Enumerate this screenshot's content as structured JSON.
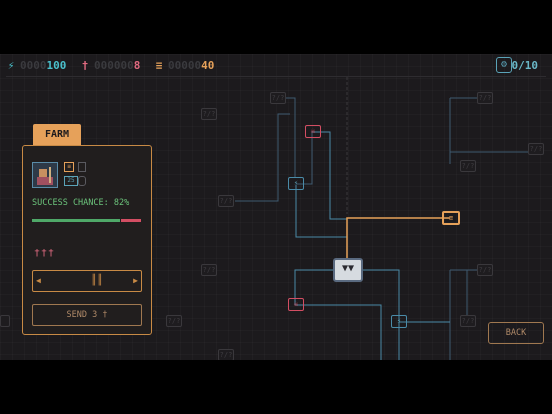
{
  "hud": {
    "energy": {
      "icon": "lightning-icon",
      "dim": "0000",
      "value": "100",
      "color": "#4ac0cc"
    },
    "population": {
      "icon": "person-icon",
      "dim": "000000",
      "value": "8",
      "color": "#e06a80"
    },
    "food": {
      "icon": "food-icon",
      "dim": "00000",
      "value": "40",
      "color": "#e6a15a"
    },
    "units": {
      "icon": "gear-icon",
      "value": "0/10",
      "color": "#6ab8c8"
    }
  },
  "panel": {
    "title": "FARM",
    "success_text": "SUCCESS CHANCE: 82%",
    "success_chance": 0.82,
    "people_icons": "†††",
    "badge_value": "25",
    "send_label": "SEND 3 †"
  },
  "back_label": "BACK",
  "locked_label": "?/?",
  "colors": {
    "accent": "#e6a15a",
    "cyan": "#5aa3b8",
    "red": "#d34e63",
    "green": "#4fa868"
  }
}
